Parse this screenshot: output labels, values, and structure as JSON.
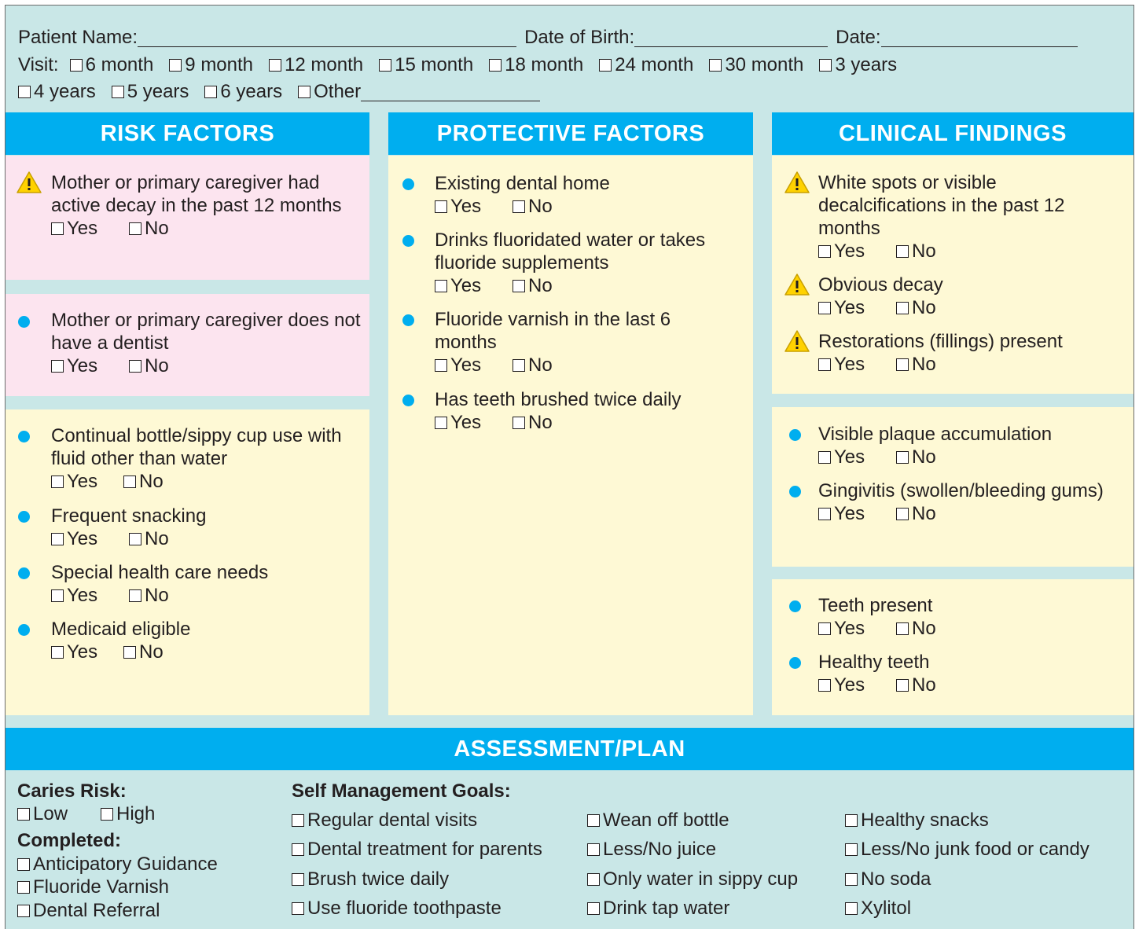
{
  "header": {
    "patient_name_label": "Patient Name:",
    "dob_label": "Date of Birth:",
    "date_label": "Date:",
    "visit_label": "Visit:",
    "visit_options": [
      "6 month",
      "9 month",
      "12 month",
      "15 month",
      "18 month",
      "24 month",
      "30 month",
      "3 years",
      "4 years",
      "5 years",
      "6 years",
      "Other"
    ]
  },
  "yes_label": "Yes",
  "no_label": "No",
  "risk": {
    "title": "RISK FACTORS",
    "items": [
      "Mother or primary caregiver had active decay in the past 12 months",
      "Mother or primary caregiver does not have a dentist",
      "Continual bottle/sippy cup use with fluid other than water",
      "Frequent snacking",
      "Special health care needs",
      "Medicaid eligible"
    ]
  },
  "protective": {
    "title": "PROTECTIVE FACTORS",
    "items": [
      "Existing dental home",
      "Drinks fluoridated water or takes fluoride supplements",
      "Fluoride varnish in the last 6 months",
      "Has teeth brushed twice daily"
    ]
  },
  "clinical": {
    "title": "CLINICAL FINDINGS",
    "items": [
      "White spots or visible decalcifications in the past 12 months",
      "Obvious decay",
      "Restorations (fillings) present",
      "Visible plaque accumulation",
      "Gingivitis (swollen/bleeding gums)",
      "Teeth present",
      "Healthy teeth"
    ]
  },
  "plan": {
    "title": "ASSESSMENT/PLAN",
    "caries_label": "Caries Risk:",
    "caries_options": [
      "Low",
      "High"
    ],
    "completed_label": "Completed:",
    "completed_options": [
      "Anticipatory Guidance",
      "Fluoride Varnish",
      "Dental Referral"
    ],
    "goals_label": "Self Management Goals:",
    "goals_col1": [
      "Regular dental visits",
      "Dental treatment for parents",
      "Brush twice daily",
      "Use fluoride toothpaste"
    ],
    "goals_col2": [
      "Wean off bottle",
      "Less/No juice",
      "Only water in sippy cup",
      "Drink tap water"
    ],
    "goals_col3": [
      "Healthy snacks",
      "Less/No junk food or candy",
      "No soda",
      "Xylitol"
    ]
  },
  "colors": {
    "header_blue": "#00aeef",
    "panel_teal": "#c9e7e7",
    "risk_pink": "#fce4ef",
    "note_yellow": "#fef9d5",
    "warning_yellow": "#ffd200"
  }
}
